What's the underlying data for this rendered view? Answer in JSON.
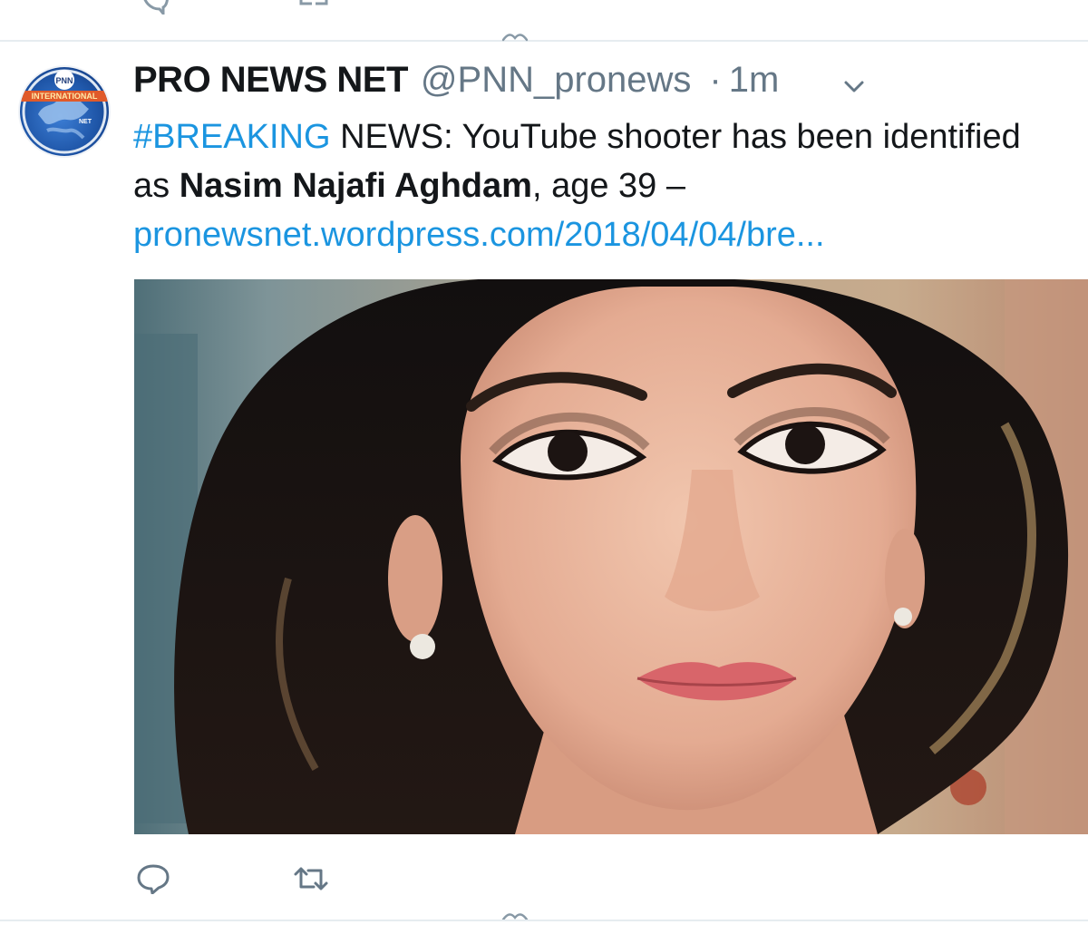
{
  "tweet": {
    "author_name": "PRO NEWS NET",
    "handle": "@PNN_pronews",
    "separator": "·",
    "time": "1m",
    "text": {
      "hashtag": "#BREAKING",
      "line1_rest": " NEWS: YouTube shooter has been identified",
      "line2_prefix": "as ",
      "line2_bold": "Nasim Najafi Aghdam",
      "line2_suffix": ", age 39 –",
      "link": "pronewsnet.wordpress.com/2018/04/04/bre..."
    },
    "avatar": {
      "text_top": "PNN",
      "text_band": "INTERNATIONAL",
      "text_right": "NET",
      "colors": {
        "globe": "#1f56a8",
        "band": "#e05a2a"
      }
    },
    "actions": [
      "reply-icon",
      "retweet-icon"
    ],
    "menu_icon": "chevron-down-icon"
  },
  "colors": {
    "link": "#1b95e0",
    "text": "#14171a",
    "muted": "#657786",
    "divider": "#e6ecf0"
  }
}
